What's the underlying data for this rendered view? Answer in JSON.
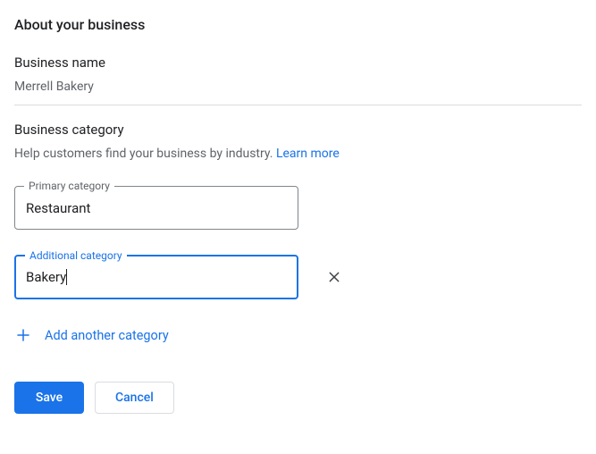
{
  "pageTitle": "About your business",
  "businessName": {
    "label": "Business name",
    "value": "Merrell Bakery"
  },
  "businessCategory": {
    "label": "Business category",
    "helpText": "Help customers find your business by industry. ",
    "learnMoreLabel": "Learn more",
    "primary": {
      "label": "Primary category",
      "value": "Restaurant"
    },
    "additional": {
      "label": "Additional category",
      "value": "Bakery"
    },
    "addAnotherLabel": "Add another category"
  },
  "buttons": {
    "save": "Save",
    "cancel": "Cancel"
  }
}
